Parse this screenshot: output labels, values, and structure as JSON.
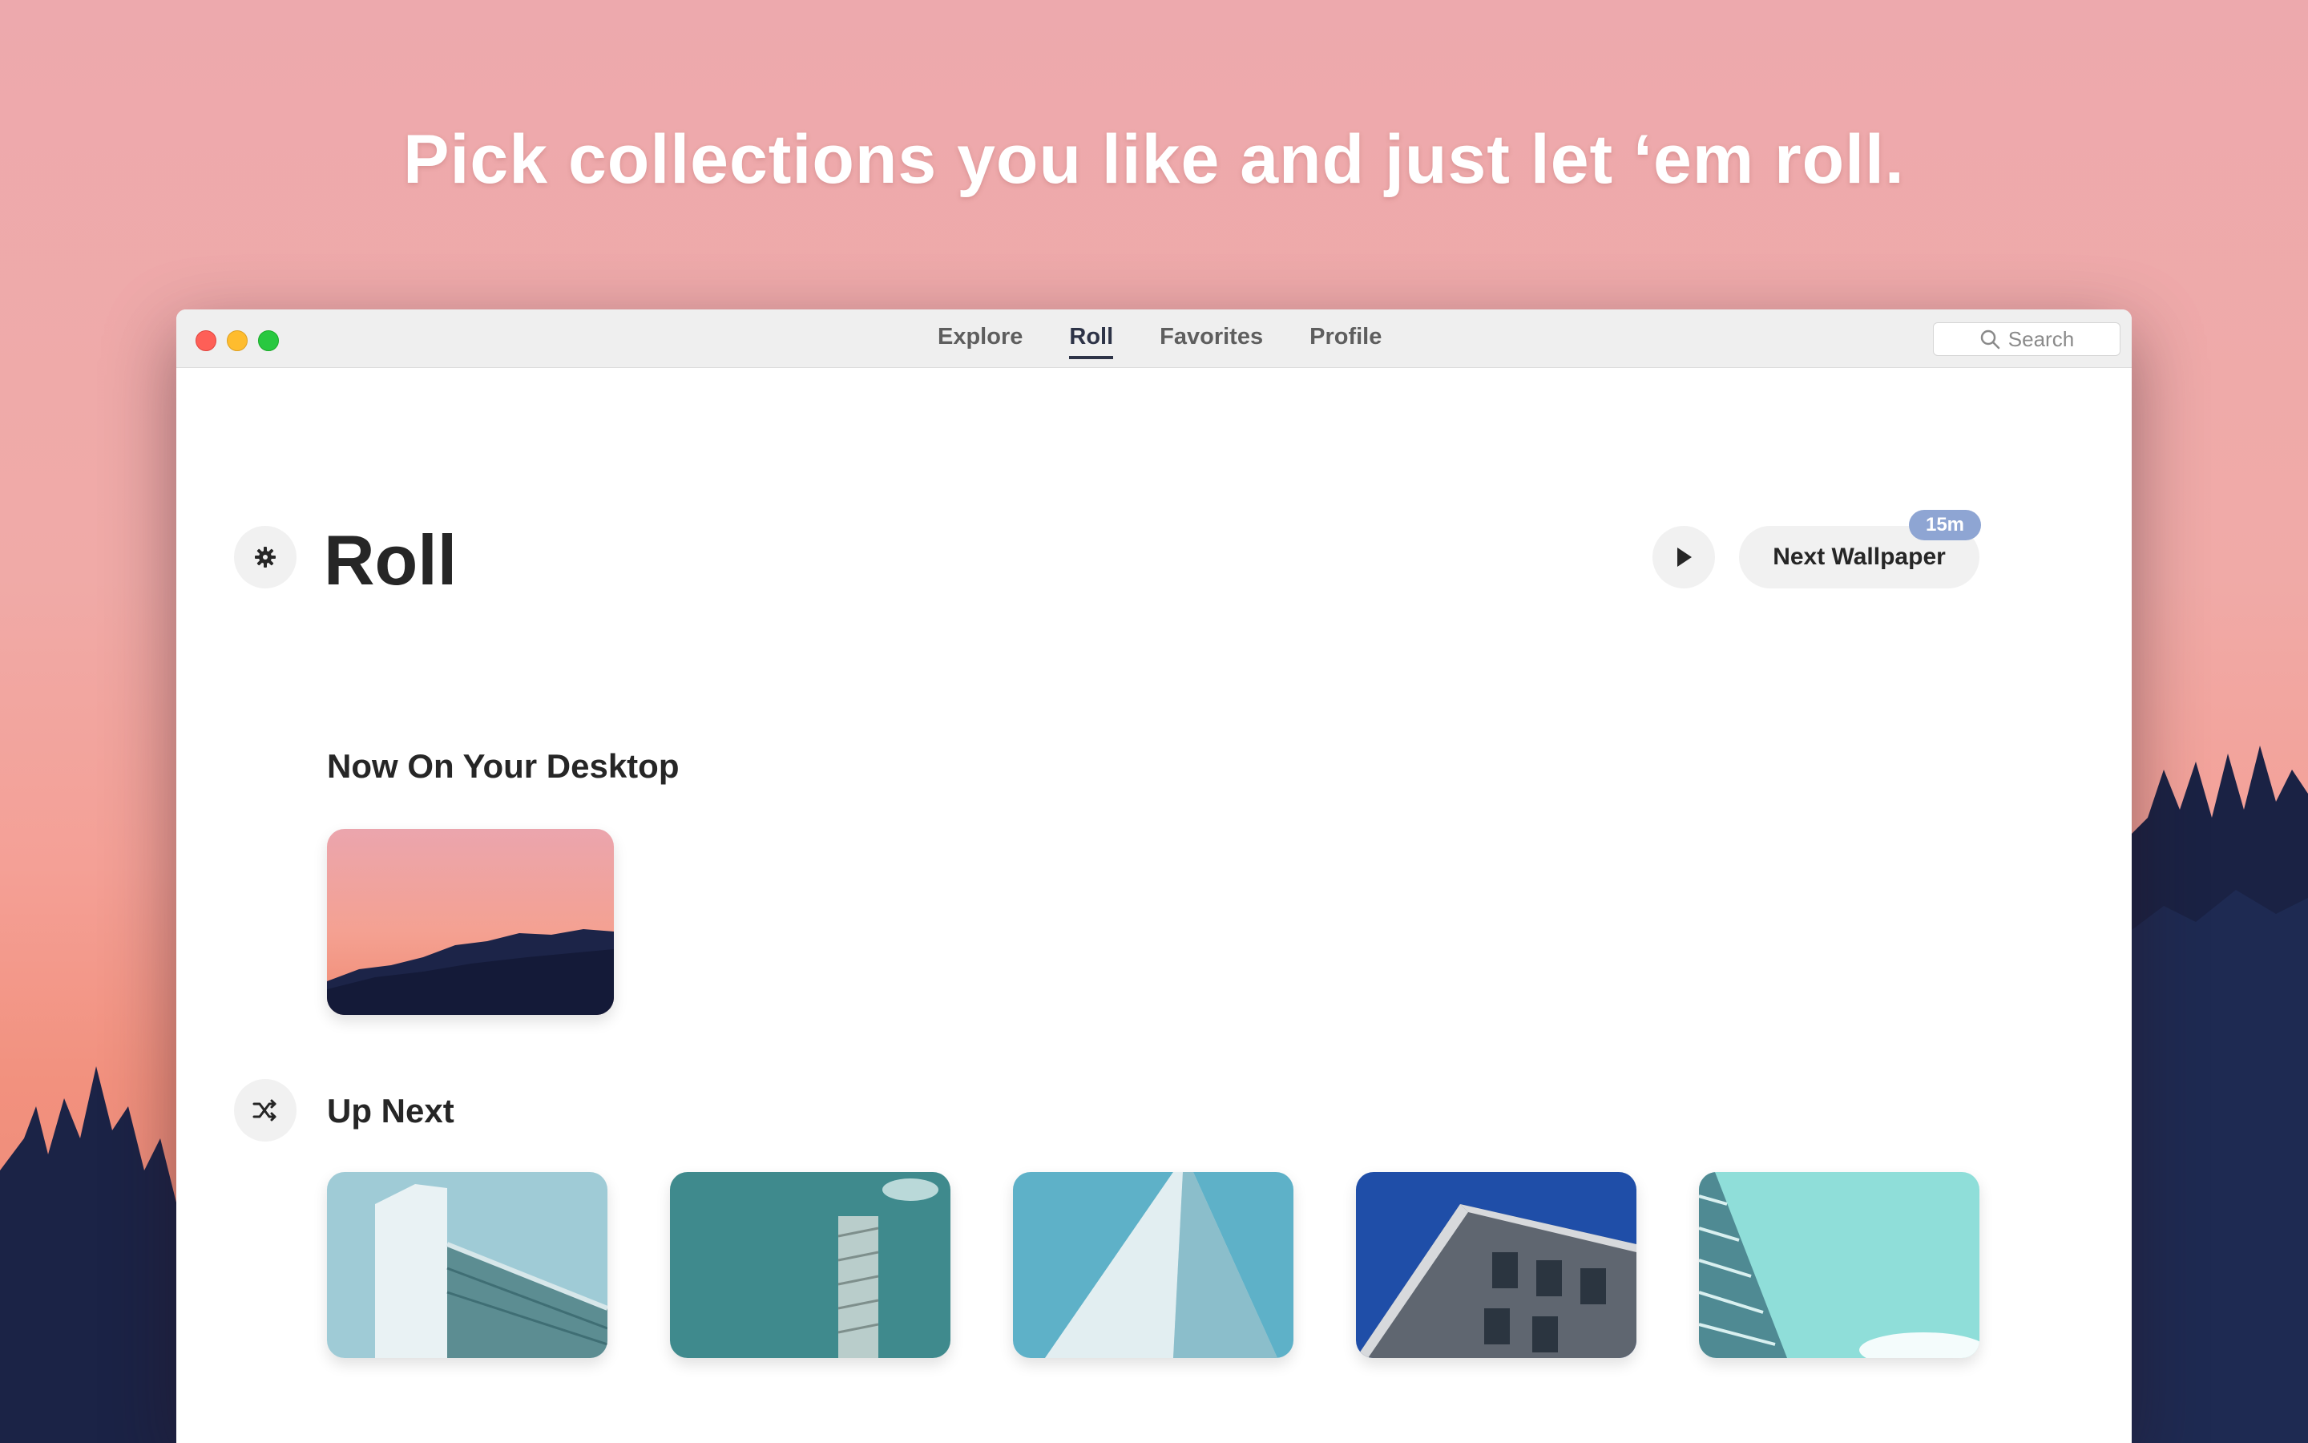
{
  "headline": "Pick collections you like and just let ‘em roll.",
  "nav": {
    "tabs": [
      {
        "label": "Explore"
      },
      {
        "label": "Roll"
      },
      {
        "label": "Favorites"
      },
      {
        "label": "Profile"
      }
    ],
    "active_tab": "Roll"
  },
  "search": {
    "placeholder": "Search"
  },
  "page": {
    "title": "Roll",
    "next_wallpaper_label": "Next Wallpaper",
    "interval_badge": "15m"
  },
  "sections": {
    "now_title": "Now On Your Desktop",
    "up_next_title": "Up Next"
  },
  "icons": {
    "settings": "gear-icon",
    "play": "play-icon",
    "shuffle": "shuffle-icon",
    "search": "search-icon"
  },
  "colors": {
    "accent_badge": "#8ea5d3",
    "text_dark": "#262626",
    "active_tab": "#2d3347"
  }
}
